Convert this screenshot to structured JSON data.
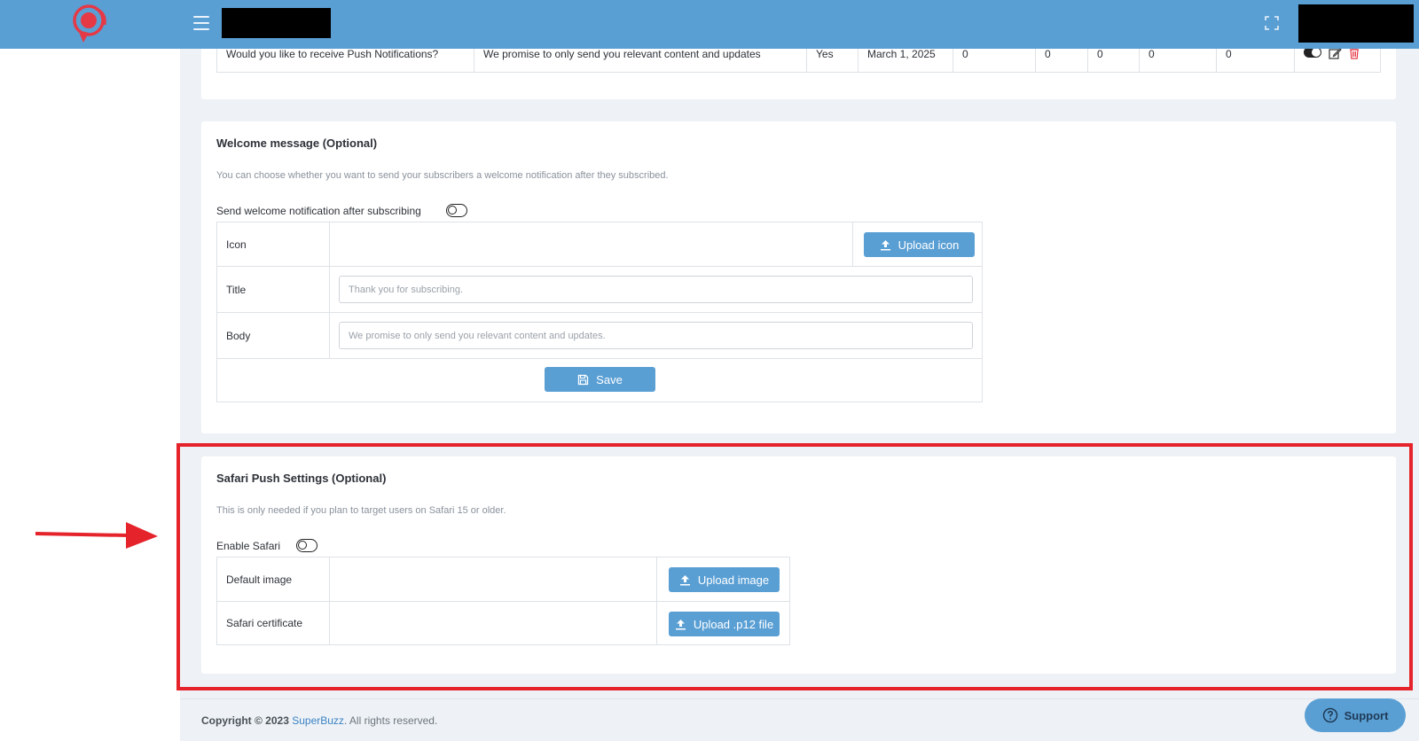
{
  "colors": {
    "navbar": "#5a9fd4",
    "primary_button": "#5a9fd4",
    "annotation_red": "#e5232b",
    "logo_red": "#e53946",
    "delete_red": "#e53946"
  },
  "navbar": {
    "menu_icon": "hamburger-icon",
    "fullscreen_icon": "fullscreen-icon",
    "redacted_left": "",
    "redacted_right": ""
  },
  "top_table_row": {
    "cells": [
      "Would you like to receive Push Notifications?",
      "We promise to only send you relevant content and updates",
      "Yes",
      "March 1, 2025",
      "0",
      "0",
      "0",
      "0",
      "0"
    ],
    "action_icons": [
      "toggle-on-icon",
      "edit-icon",
      "trash-icon"
    ]
  },
  "welcome": {
    "title": "Welcome message (Optional)",
    "hint": "You can choose whether you want to send your subscribers a welcome notification after they subscribed.",
    "toggle_label": "Send welcome notification after subscribing",
    "toggle_on": false,
    "rows": {
      "icon_label": "Icon",
      "upload_icon_label": "Upload icon",
      "title_label": "Title",
      "title_placeholder": "Thank you for subscribing.",
      "body_label": "Body",
      "body_placeholder": "We promise to only send you relevant content and updates."
    },
    "save_label": "Save"
  },
  "safari": {
    "title": "Safari Push Settings (Optional)",
    "hint": "This is only needed if you plan to target users on Safari 15 or older.",
    "toggle_label": "Enable Safari",
    "toggle_on": false,
    "rows": {
      "default_image_label": "Default image",
      "upload_image_label": "Upload image",
      "certificate_label": "Safari certificate",
      "upload_p12_label": "Upload .p12 file"
    }
  },
  "footer": {
    "copyright_prefix": "Copyright © 2023",
    "brand": "SuperBuzz",
    "suffix": ". All rights reserved."
  },
  "support": {
    "label": "Support",
    "icon": "help-circle-icon"
  }
}
